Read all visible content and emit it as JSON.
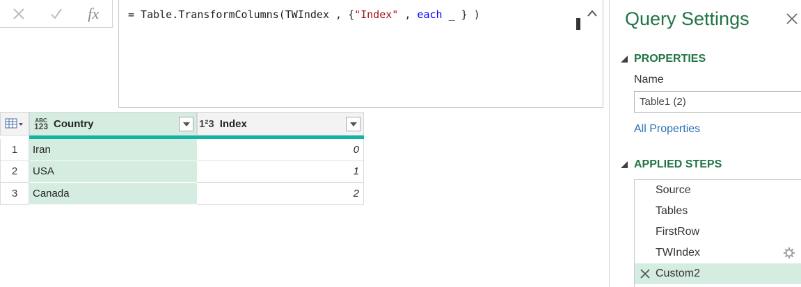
{
  "formula_bar": {
    "cancel_icon": "close-icon",
    "confirm_icon": "check-icon",
    "fx_label": "fx",
    "formula_prefix": "= Table.TransformColumns(TWIndex , {",
    "formula_string": "\"Index\"",
    "formula_sep": " , ",
    "formula_keyword": "each",
    "formula_suffix": " _ } )"
  },
  "grid": {
    "columns": [
      {
        "name": "Country",
        "type_label_top": "ABC",
        "type_label_bottom": "123"
      },
      {
        "name": "Index",
        "type_label": "1²3"
      }
    ],
    "rows": [
      {
        "num": "1",
        "country": "Iran",
        "index": "0"
      },
      {
        "num": "2",
        "country": "USA",
        "index": "1"
      },
      {
        "num": "3",
        "country": "Canada",
        "index": "2"
      }
    ]
  },
  "settings": {
    "title": "Query Settings",
    "properties_heading": "PROPERTIES",
    "name_label": "Name",
    "name_value": "Table1 (2)",
    "all_properties_link": "All Properties",
    "applied_steps_heading": "APPLIED STEPS",
    "steps": [
      {
        "label": "Source"
      },
      {
        "label": "Tables"
      },
      {
        "label": "FirstRow"
      },
      {
        "label": "TWIndex"
      },
      {
        "label": "Custom2"
      }
    ]
  },
  "colors": {
    "accent_green": "#217346",
    "selected_fill": "#d5ede0",
    "teal_bar": "#12b3a3",
    "link_blue": "#2a72b5"
  }
}
